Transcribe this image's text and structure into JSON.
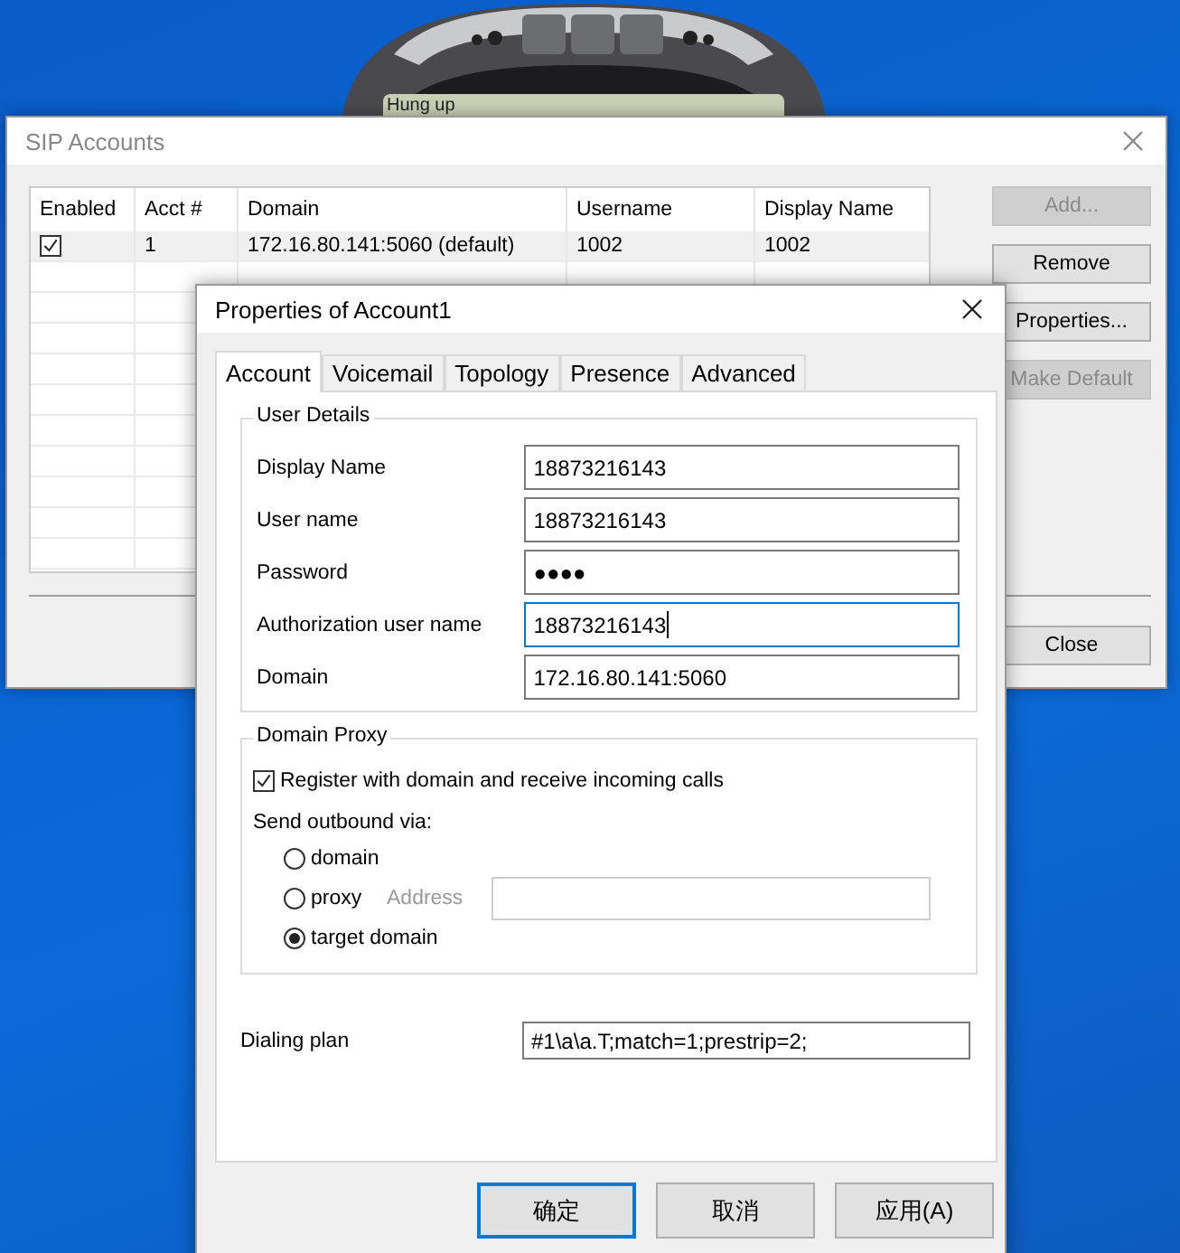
{
  "phone": {
    "status": "Hung up"
  },
  "sip_window": {
    "title": "SIP Accounts",
    "table": {
      "columns": [
        "Enabled",
        "Acct #",
        "Domain",
        "Username",
        "Display Name"
      ],
      "rows": [
        {
          "enabled": true,
          "selected": true,
          "cells": [
            "",
            "1",
            "172.16.80.141:5060 (default)",
            "1002",
            "1002"
          ]
        }
      ]
    },
    "buttons": [
      {
        "label": "Add...",
        "disabled": true
      },
      {
        "label": "Remove",
        "disabled": false
      },
      {
        "label": "Properties...",
        "disabled": false
      },
      {
        "label": "Make Default",
        "disabled": true
      }
    ],
    "close_button": {
      "label": "Close"
    }
  },
  "properties_dialog": {
    "title": "Properties of Account1",
    "tabs": [
      {
        "label": "Account",
        "selected": true
      },
      {
        "label": "Voicemail",
        "selected": false
      },
      {
        "label": "Topology",
        "selected": false
      },
      {
        "label": "Presence",
        "selected": false
      },
      {
        "label": "Advanced",
        "selected": false
      }
    ],
    "user_details": {
      "title": "User Details",
      "fields": [
        {
          "label": "Display Name",
          "value": "18873216143",
          "focused": false
        },
        {
          "label": "User name",
          "value": "18873216143",
          "focused": false
        },
        {
          "label": "Password",
          "value": "●●●●",
          "focused": false
        },
        {
          "label": "Authorization user name",
          "value": "18873216143",
          "focused": true
        },
        {
          "label": "Domain",
          "value": "172.16.80.141:5060",
          "focused": false
        }
      ]
    },
    "domain_proxy": {
      "title": "Domain Proxy",
      "register": {
        "label": "Register with domain and receive incoming calls",
        "checked": true
      },
      "send_via_label": "Send outbound via:",
      "options": [
        {
          "label": "domain",
          "selected": false
        },
        {
          "label": "proxy",
          "selected": false
        },
        {
          "label": "target domain",
          "selected": true
        }
      ],
      "address": {
        "label": "Address",
        "disabled": true
      }
    },
    "dialing_plan": {
      "label": "Dialing plan",
      "value": "#1\\a\\a.T;match=1;prestrip=2;"
    },
    "buttons": [
      {
        "label": "确定",
        "default": true
      },
      {
        "label": "取消",
        "default": false
      },
      {
        "label": "应用(A)",
        "default": false
      }
    ]
  }
}
